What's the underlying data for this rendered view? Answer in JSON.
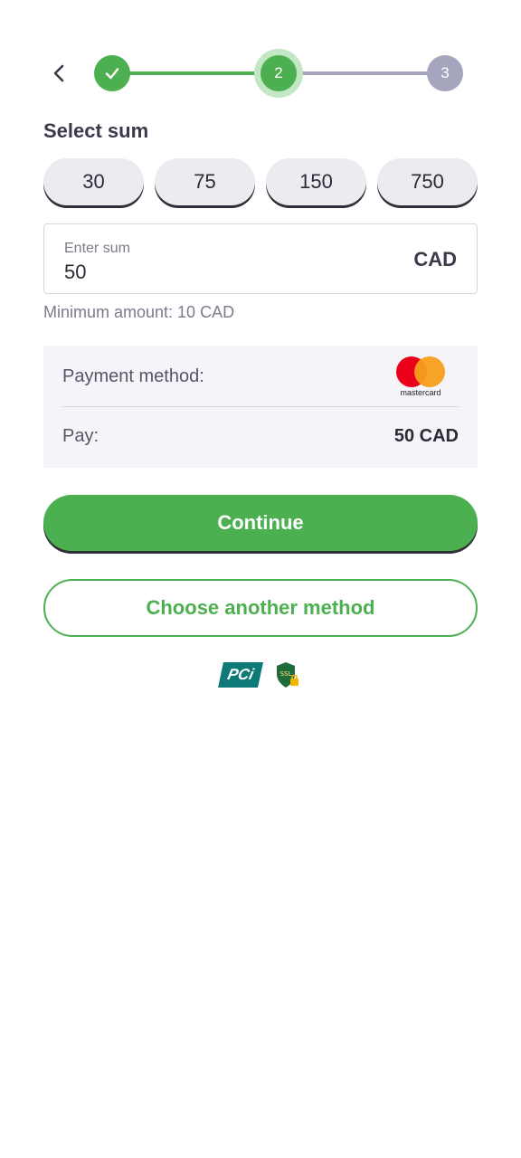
{
  "nav": {
    "back_icon": "chevron-left-icon"
  },
  "stepper": {
    "steps": [
      {
        "label": "",
        "state": "completed",
        "icon": "check-icon"
      },
      {
        "label": "2",
        "state": "active"
      },
      {
        "label": "3",
        "state": "pending"
      }
    ],
    "colors": {
      "active": "#4caf50",
      "pending": "#a5a5bd"
    }
  },
  "select_sum": {
    "title": "Select sum",
    "options": [
      "30",
      "75",
      "150",
      "750"
    ]
  },
  "sum_field": {
    "label": "Enter sum",
    "value": "50",
    "currency": "CAD"
  },
  "minimum_note": "Minimum amount: 10 CAD",
  "summary": {
    "payment_method_label": "Payment method:",
    "payment_method_logo": "mastercard",
    "pay_label": "Pay:",
    "pay_value": "50 CAD"
  },
  "buttons": {
    "continue": "Continue",
    "choose_another": "Choose another method"
  },
  "badges": {
    "pci": "PCi",
    "ssl": "SSL"
  },
  "colors": {
    "accent": "#4caf50",
    "panel_bg": "#f5f5f9"
  }
}
